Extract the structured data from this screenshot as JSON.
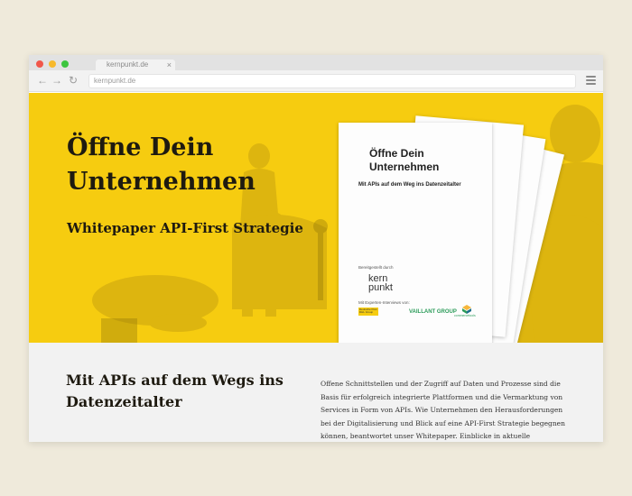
{
  "browser": {
    "tab_title": "kernpunkt.de",
    "tab_close": "×",
    "url": "kernpunkt.de",
    "nav": {
      "back": "←",
      "forward": "→",
      "reload": "↻"
    }
  },
  "hero": {
    "title": "Öffne Dein Unternehmen",
    "subtitle": "Whitepaper API-First Strategie",
    "background_color": "#f6cc10"
  },
  "whitepaper": {
    "title_line1": "Öffne Dein",
    "title_line2": "Unternehmen",
    "subtitle": "Mit APIs auf dem Weg ins Datenzeitalter",
    "credit": "Bereitgestellt durch",
    "logo_line1": "kern",
    "logo_line2": "punkt",
    "interviews": "Mit Experten-Interviews von:",
    "partner_dhl": "Deutsche Post DHL Group",
    "partner_vaillant": "VAILLANT GROUP",
    "partner_cc": "commercetools"
  },
  "content": {
    "heading": "Mit APIs auf dem Wegs ins Datenzeitalter",
    "body": "Offene Schnittstellen und der Zugriff auf Daten und Prozesse sind die Basis für erfolgreich integrierte Plattformen und die Vermarktung von Services in Form von APIs. Wie Unternehmen den Herausforderungen bei der Digitalisierung und Blick auf eine API-First Strategie begegnen können, beantwortet unser Whitepaper. Einblicke in aktuelle Strategien erfolgreicher Unternehmen und"
  }
}
